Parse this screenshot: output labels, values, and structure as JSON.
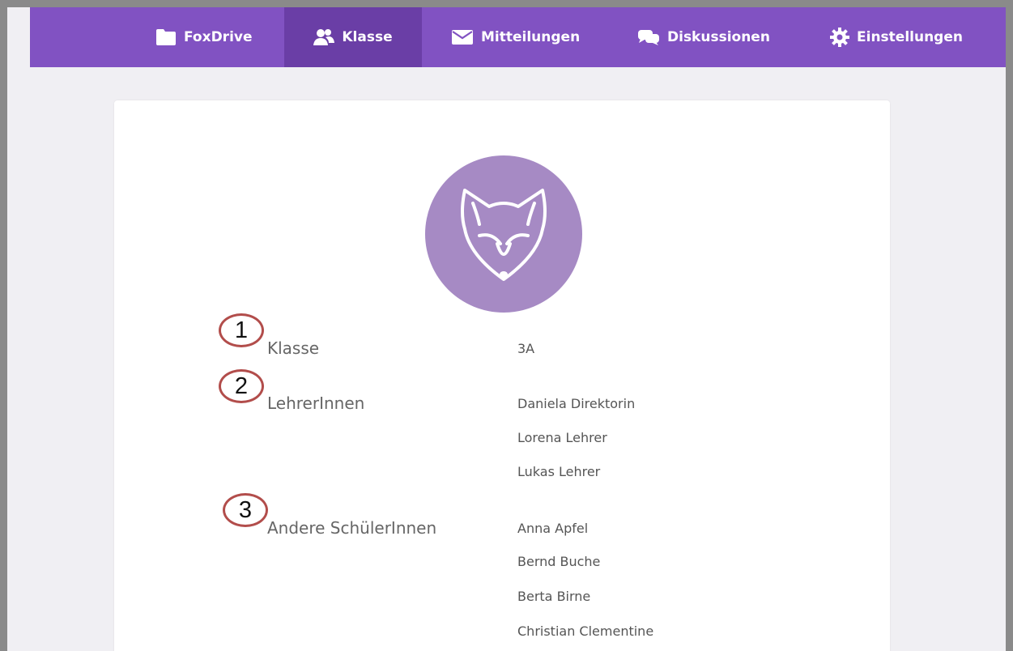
{
  "nav": {
    "items": [
      {
        "label": "FoxDrive",
        "icon": "folder-icon"
      },
      {
        "label": "Klasse",
        "icon": "users-icon",
        "active": true
      },
      {
        "label": "Mitteilungen",
        "icon": "envelope-icon"
      },
      {
        "label": "Diskussionen",
        "icon": "chat-bubbles-icon"
      },
      {
        "label": "Einstellungen",
        "icon": "gear-icon"
      }
    ],
    "accent": "#8152c2",
    "active_color": "#6a3ea6"
  },
  "profile": {
    "avatar_icon": "fox-icon",
    "avatar_color": "#a68ac4"
  },
  "class_info": {
    "klasse_label": "Klasse",
    "klasse_value": "3A",
    "teachers_label": "LehrerInnen",
    "teachers": [
      "Daniela Direktorin",
      "Lorena Lehrer",
      "Lukas Lehrer"
    ],
    "students_label": "Andere SchülerInnen",
    "students": [
      "Anna Apfel",
      "Bernd Buche",
      "Berta Birne",
      "Christian Clementine"
    ]
  },
  "annotations": {
    "badges": [
      "1",
      "2",
      "3"
    ],
    "color": "#b24d4b"
  }
}
